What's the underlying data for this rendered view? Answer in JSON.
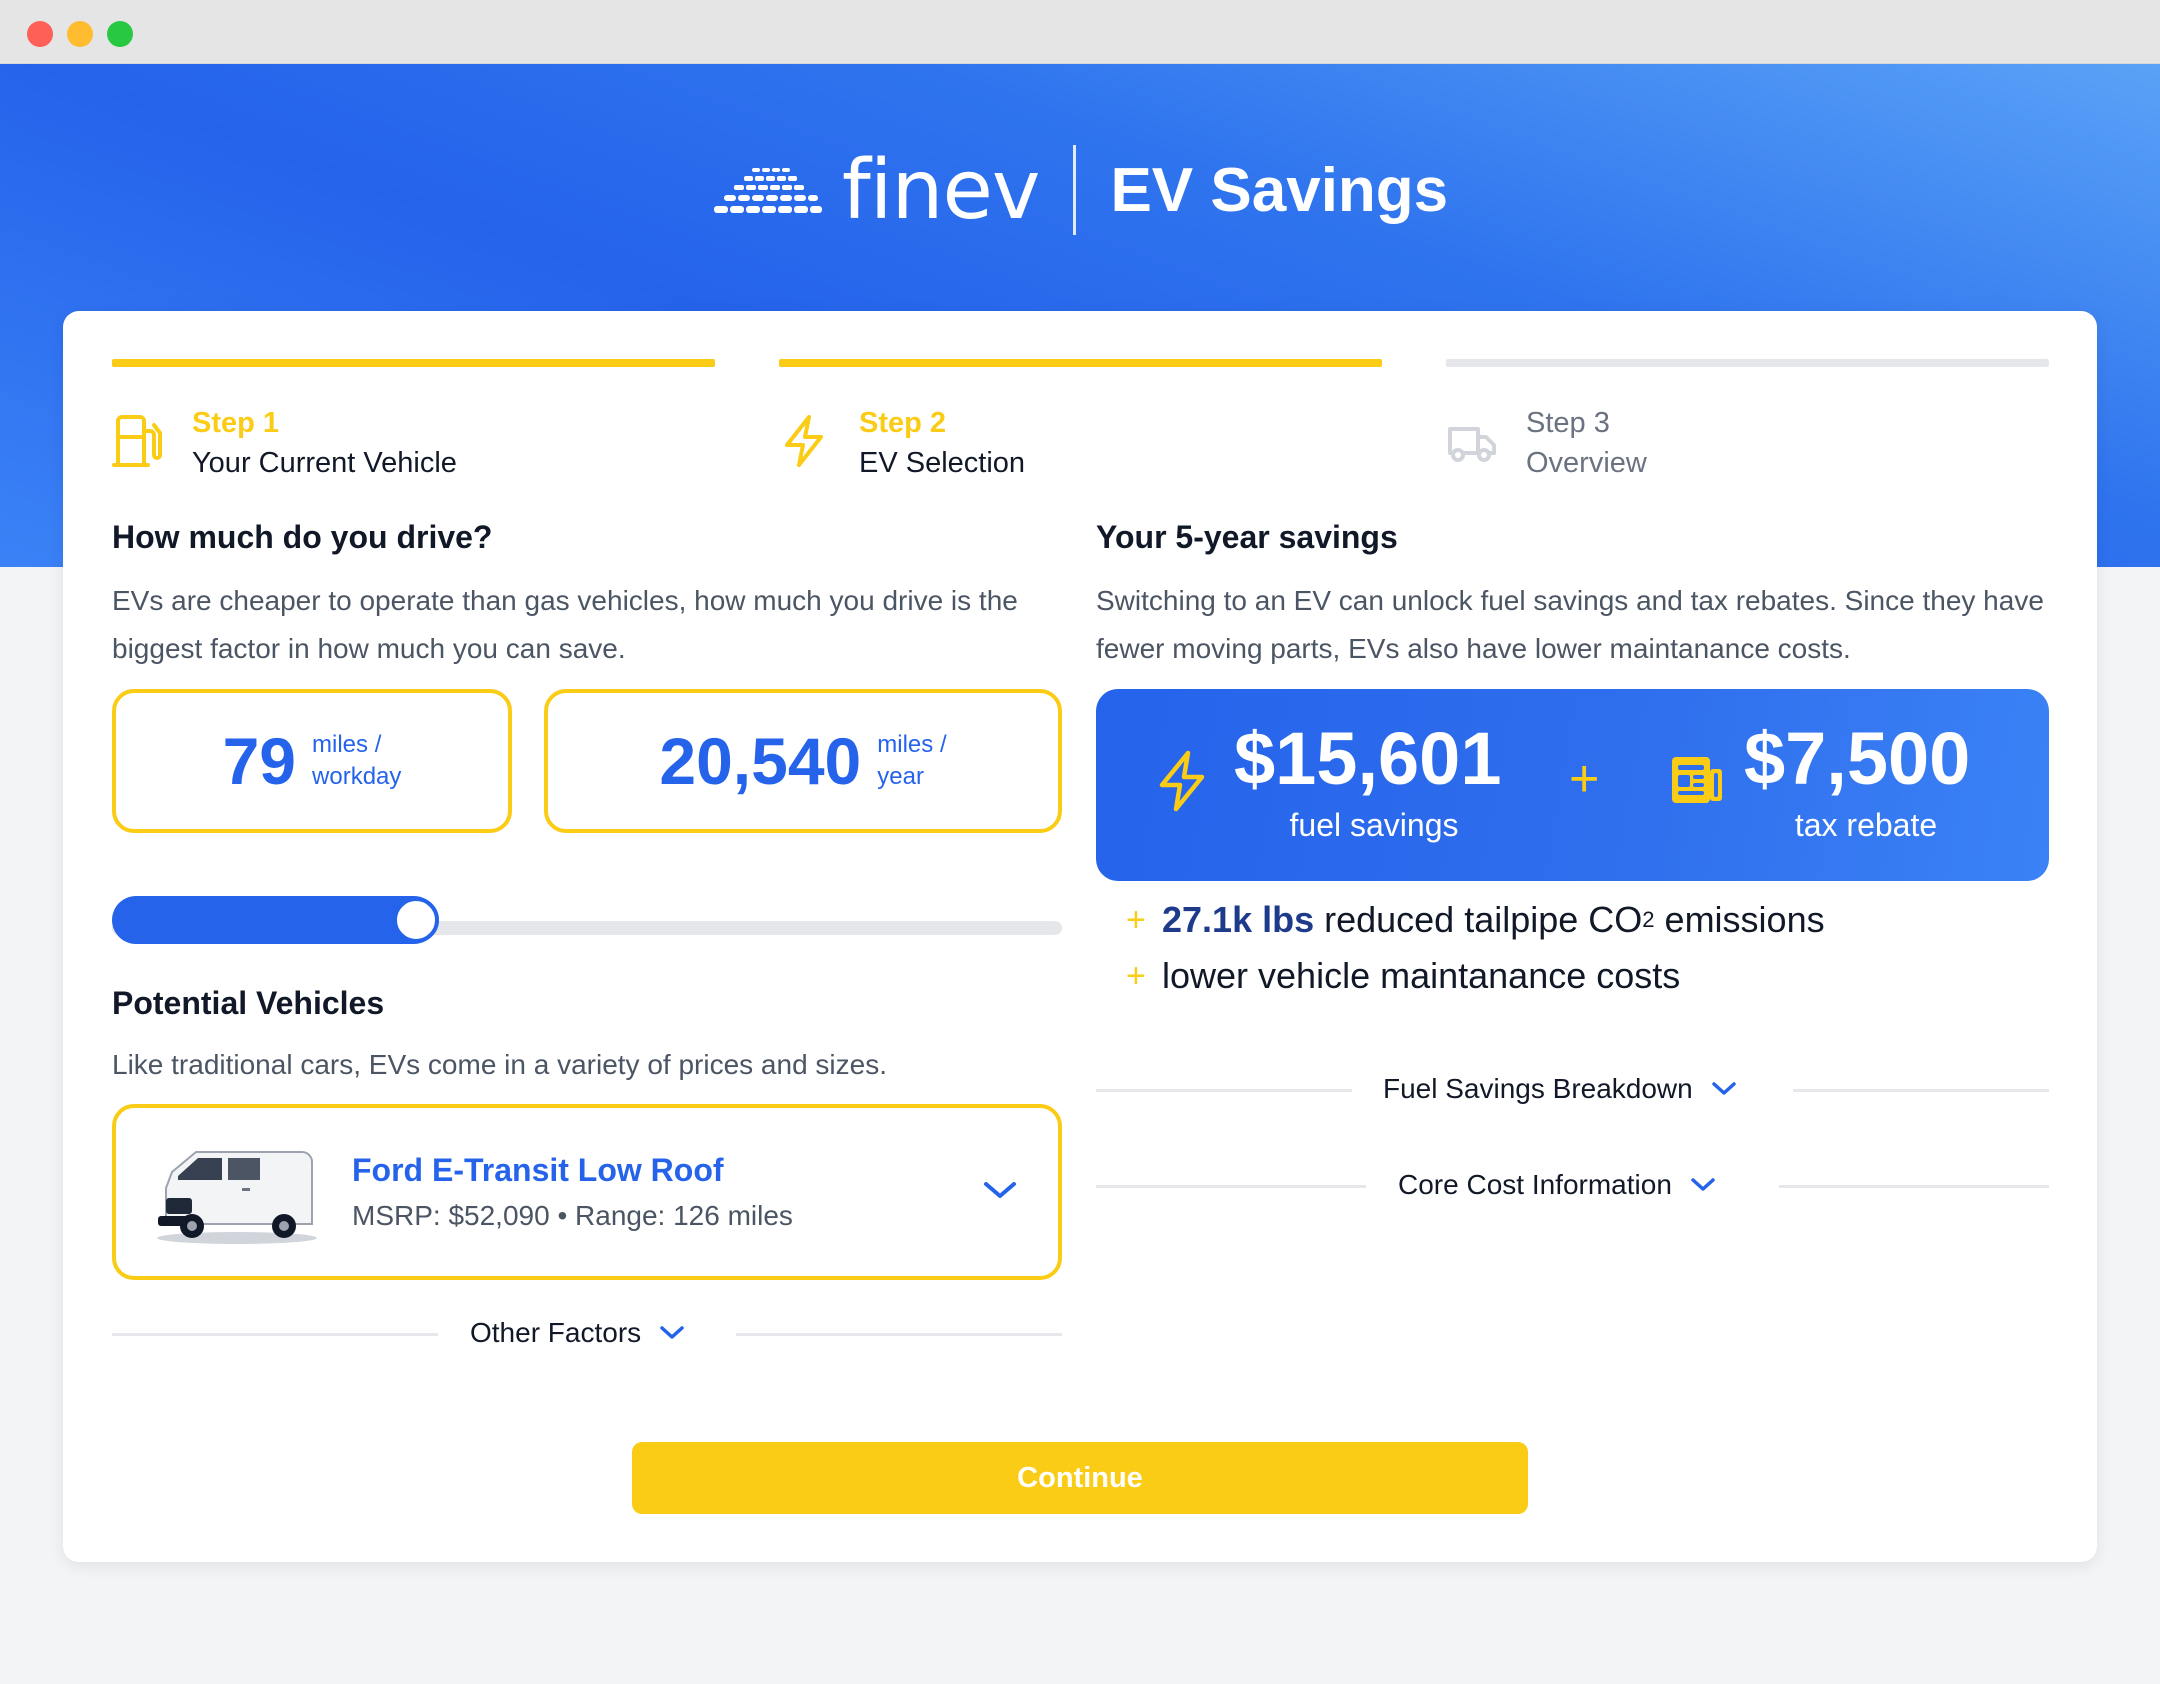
{
  "brand": {
    "name": "finev",
    "product": "EV Savings"
  },
  "steps": [
    {
      "num": "Step 1",
      "label": "Your Current Vehicle",
      "icon": "gas-pump-icon"
    },
    {
      "num": "Step 2",
      "label": "EV Selection",
      "icon": "lightning-icon"
    },
    {
      "num": "Step 3",
      "label": "Overview",
      "icon": "truck-icon"
    }
  ],
  "drive": {
    "title": "How much do you drive?",
    "desc": "EVs are cheaper to operate than gas vehicles, how much you drive is the biggest factor in how much you can save.",
    "workday": {
      "value": "79",
      "unit_line1": "miles /",
      "unit_line2": "workday"
    },
    "year": {
      "value": "20,540",
      "unit_line1": "miles /",
      "unit_line2": "year"
    },
    "slider_fraction": 0.32
  },
  "vehicles": {
    "title": "Potential Vehicles",
    "desc": "Like traditional cars, EVs come in a variety of prices and sizes.",
    "selected_name": "Ford E-Transit Low Roof",
    "selected_meta": "MSRP: $52,090 • Range: 126 miles",
    "other_factors": "Other Factors"
  },
  "savings": {
    "title": "Your 5-year savings",
    "desc": "Switching to an EV can unlock fuel savings and tax rebates. Since they have fewer moving parts, EVs also have lower maintanance costs.",
    "fuel_amount": "$15,601",
    "fuel_label": "fuel savings",
    "tax_amount": "$7,500",
    "tax_label": "tax rebate",
    "plus": "+",
    "bullet1_strong": "27.1k lbs",
    "bullet1_text": "reduced tailpipe CO",
    "bullet1_sup": "2",
    "bullet1_tail": "emissions",
    "bullet2_text": "lower vehicle maintanance costs",
    "breakdown": "Fuel Savings Breakdown",
    "core_cost": "Core Cost Information"
  },
  "continue_label": "Continue",
  "colors": {
    "accent_blue": "#2563eb",
    "accent_yellow": "#facc15"
  }
}
